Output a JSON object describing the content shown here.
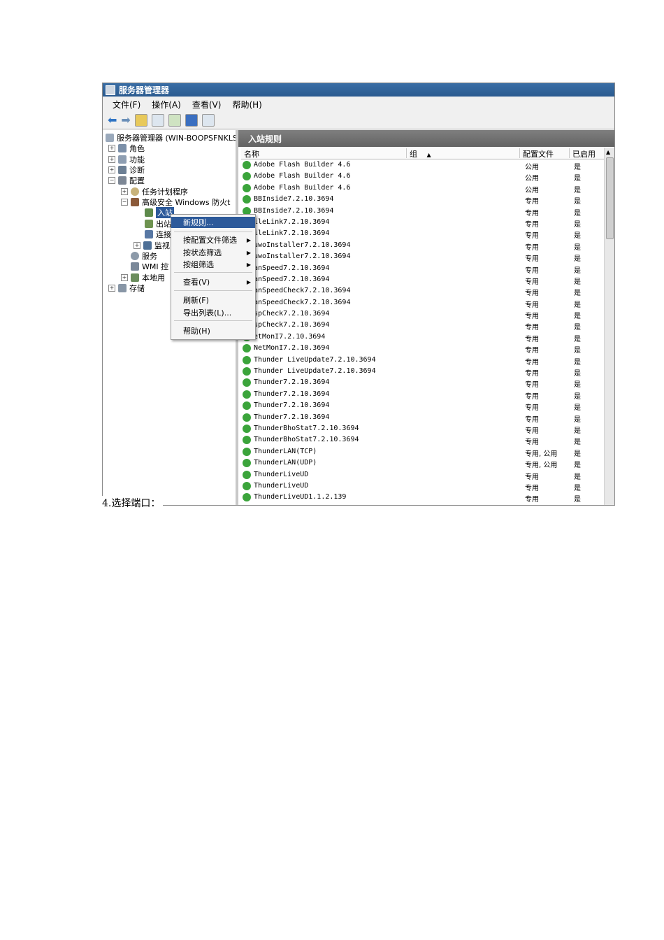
{
  "window": {
    "title": "服务器管理器",
    "menu": [
      "文件(F)",
      "操作(A)",
      "查看(V)",
      "帮助(H)"
    ]
  },
  "tree": {
    "root": "服务器管理器 (WIN-BOOPSFNKLS",
    "roles": "角色",
    "features": "功能",
    "diagnostics": "诊断",
    "config": "配置",
    "task_scheduler": "任务计划程序",
    "firewall": "高级安全 Windows 防火t",
    "inbound": "入站",
    "outbound": "出站",
    "connection": "连接",
    "monitor": "监视",
    "services": "服务",
    "wmi": "WMI 控",
    "local_users": "本地用",
    "storage": "存储"
  },
  "panel": {
    "title": "入站规则",
    "columns": [
      "名称",
      "组",
      "配置文件",
      "已启用"
    ]
  },
  "rules": [
    {
      "name": "Adobe Flash Builder 4.6",
      "profile": "公用",
      "enabled": "是"
    },
    {
      "name": "Adobe Flash Builder 4.6",
      "profile": "公用",
      "enabled": "是"
    },
    {
      "name": "Adobe Flash Builder 4.6",
      "profile": "公用",
      "enabled": "是"
    },
    {
      "name": "BBInside7.2.10.3694",
      "profile": "专用",
      "enabled": "是"
    },
    {
      "name": "BBInside7.2.10.3694",
      "profile": "专用",
      "enabled": "是"
    },
    {
      "name": "ileLink7.2.10.3694",
      "profile": "专用",
      "enabled": "是"
    },
    {
      "name": "ileLink7.2.10.3694",
      "profile": "专用",
      "enabled": "是"
    },
    {
      "name": "uwoInstaller7.2.10.3694",
      "profile": "专用",
      "enabled": "是"
    },
    {
      "name": "uwoInstaller7.2.10.3694",
      "profile": "专用",
      "enabled": "是"
    },
    {
      "name": "anSpeed7.2.10.3694",
      "profile": "专用",
      "enabled": "是"
    },
    {
      "name": "anSpeed7.2.10.3694",
      "profile": "专用",
      "enabled": "是"
    },
    {
      "name": "anSpeedCheck7.2.10.3694",
      "profile": "专用",
      "enabled": "是"
    },
    {
      "name": "anSpeedCheck7.2.10.3694",
      "profile": "专用",
      "enabled": "是"
    },
    {
      "name": "spCheck7.2.10.3694",
      "profile": "专用",
      "enabled": "是"
    },
    {
      "name": "spCheck7.2.10.3694",
      "profile": "专用",
      "enabled": "是"
    },
    {
      "name": "etMonI7.2.10.3694",
      "profile": "专用",
      "enabled": "是"
    },
    {
      "name": "NetMonI7.2.10.3694",
      "profile": "专用",
      "enabled": "是"
    },
    {
      "name": "Thunder LiveUpdate7.2.10.3694",
      "profile": "专用",
      "enabled": "是"
    },
    {
      "name": "Thunder LiveUpdate7.2.10.3694",
      "profile": "专用",
      "enabled": "是"
    },
    {
      "name": "Thunder7.2.10.3694",
      "profile": "专用",
      "enabled": "是"
    },
    {
      "name": "Thunder7.2.10.3694",
      "profile": "专用",
      "enabled": "是"
    },
    {
      "name": "Thunder7.2.10.3694",
      "profile": "专用",
      "enabled": "是"
    },
    {
      "name": "Thunder7.2.10.3694",
      "profile": "专用",
      "enabled": "是"
    },
    {
      "name": "ThunderBhoStat7.2.10.3694",
      "profile": "专用",
      "enabled": "是"
    },
    {
      "name": "ThunderBhoStat7.2.10.3694",
      "profile": "专用",
      "enabled": "是"
    },
    {
      "name": "ThunderLAN(TCP)",
      "profile": "专用, 公用",
      "enabled": "是"
    },
    {
      "name": "ThunderLAN(UDP)",
      "profile": "专用, 公用",
      "enabled": "是"
    },
    {
      "name": "ThunderLiveUD",
      "profile": "专用",
      "enabled": "是"
    },
    {
      "name": "ThunderLiveUD",
      "profile": "专用",
      "enabled": "是"
    },
    {
      "name": "ThunderLiveUD1.1.2.139",
      "profile": "专用",
      "enabled": "是"
    }
  ],
  "context_menu": {
    "new_rule": "新规则...",
    "filter_profile": "按配置文件筛选",
    "filter_state": "按状态筛选",
    "filter_group": "按组筛选",
    "view": "查看(V)",
    "refresh": "刷新(F)",
    "export": "导出列表(L)...",
    "help": "帮助(H)"
  },
  "caption": "4.选择端口：",
  "colors": {
    "title_bar": "#3a6ea5",
    "menu_highlight": "#2d5a9a",
    "check_green": "#3ba43b",
    "panel_header": "#6f6f6f"
  }
}
